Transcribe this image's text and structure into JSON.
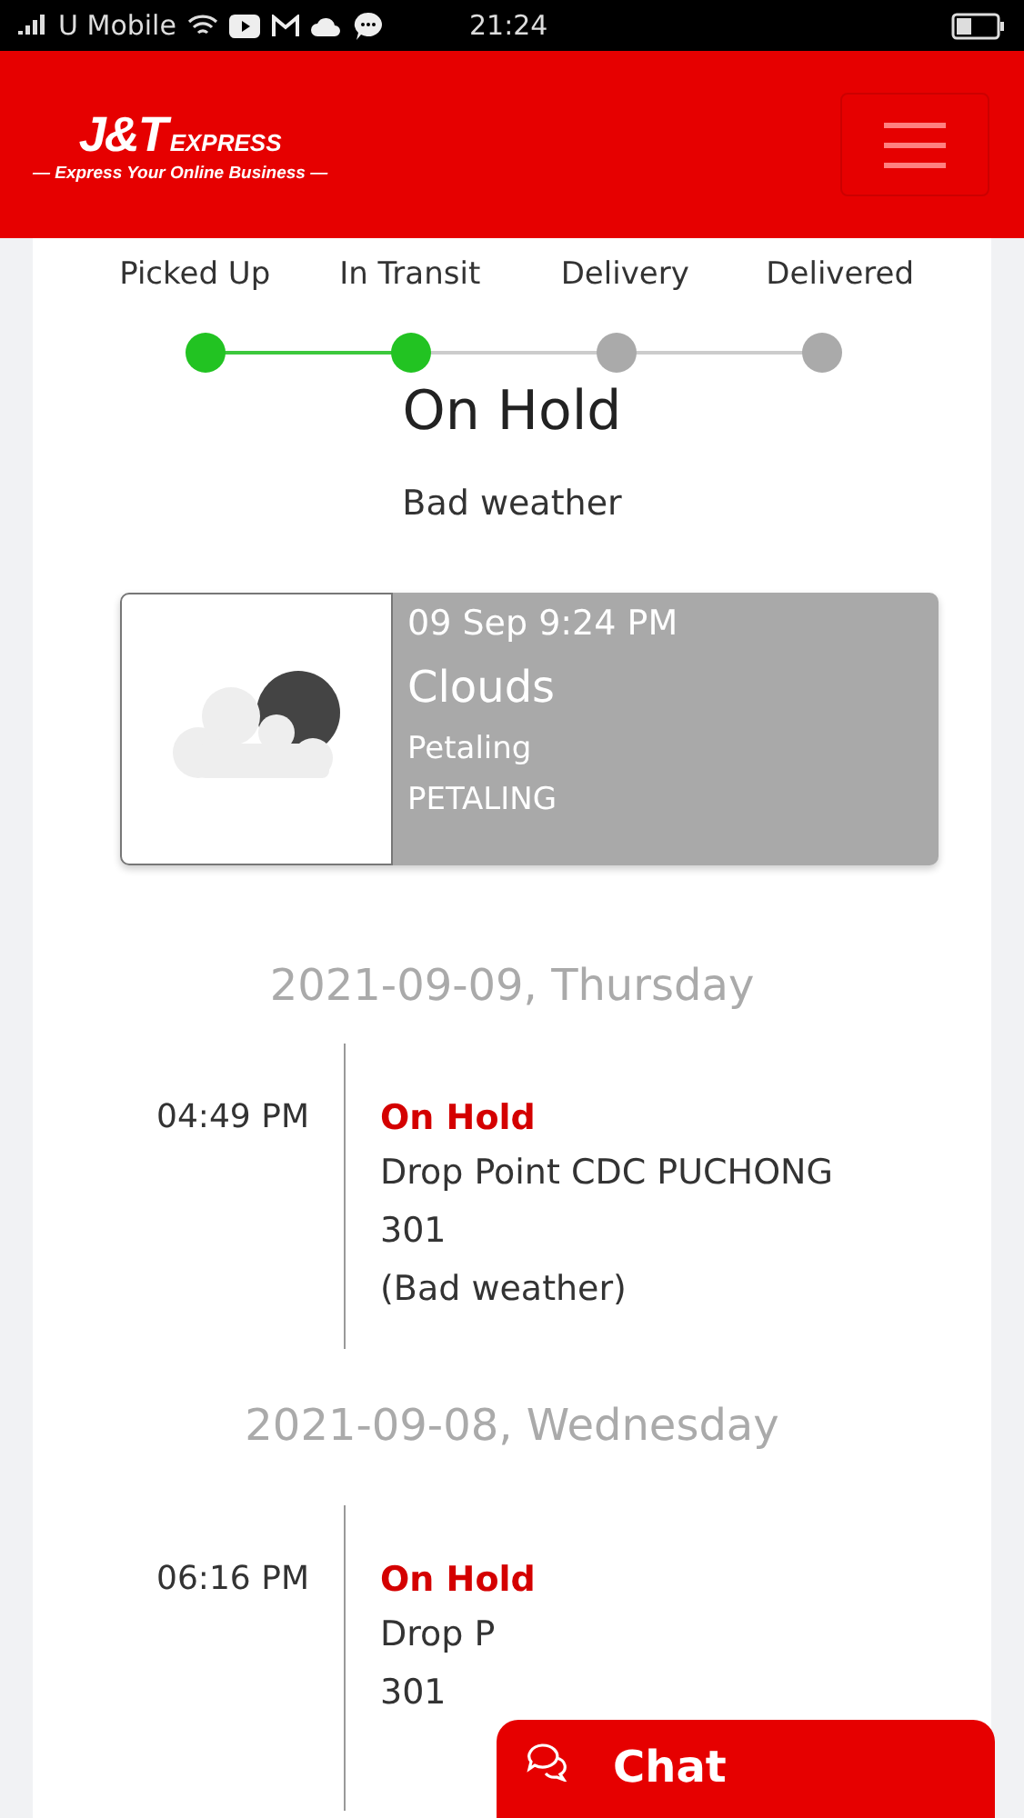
{
  "status_bar": {
    "carrier": "U Mobile",
    "time": "21:24"
  },
  "header": {
    "logo": "J&T",
    "logo_suffix": "EXPRESS",
    "tagline": "— Express Your Online Business —"
  },
  "steps": [
    {
      "label": "Picked Up",
      "done": true
    },
    {
      "label": "In Transit",
      "done": true
    },
    {
      "label": "Delivery",
      "done": false
    },
    {
      "label": "Delivered",
      "done": false
    }
  ],
  "status": {
    "title": "On Hold",
    "reason": "Bad weather"
  },
  "weather": {
    "datetime": "09 Sep  9:24 PM",
    "condition": "Clouds",
    "area": "Petaling",
    "district": "PETALING"
  },
  "days": [
    {
      "date": "2021-09-09, Thursday",
      "events": [
        {
          "time": "04:49 PM",
          "status": "On Hold",
          "lines": [
            "Drop Point CDC PUCHONG",
            "301",
            "(Bad weather)"
          ]
        }
      ]
    },
    {
      "date": "2021-09-08, Wednesday",
      "events": [
        {
          "time": "06:16 PM",
          "status": "On Hold",
          "lines": [
            "Drop P",
            "301"
          ]
        }
      ]
    }
  ],
  "chat_button": {
    "label": "Chat"
  }
}
